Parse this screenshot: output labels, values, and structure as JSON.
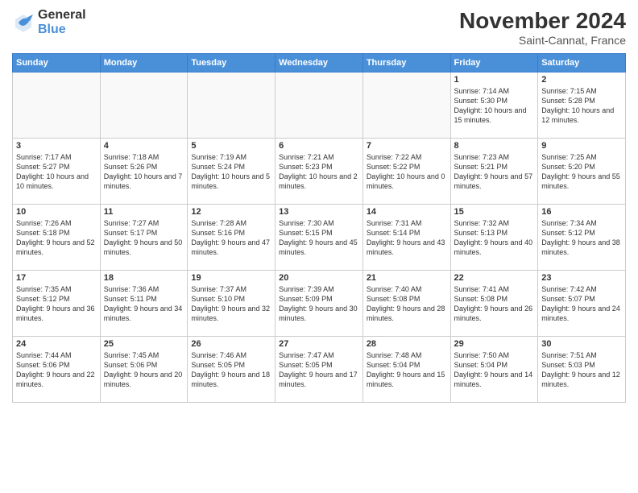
{
  "logo": {
    "general": "General",
    "blue": "Blue"
  },
  "title": "November 2024",
  "location": "Saint-Cannat, France",
  "weekdays": [
    "Sunday",
    "Monday",
    "Tuesday",
    "Wednesday",
    "Thursday",
    "Friday",
    "Saturday"
  ],
  "days": {
    "1": {
      "sunrise": "7:14 AM",
      "sunset": "5:30 PM",
      "daylight": "10 hours and 15 minutes."
    },
    "2": {
      "sunrise": "7:15 AM",
      "sunset": "5:28 PM",
      "daylight": "10 hours and 12 minutes."
    },
    "3": {
      "sunrise": "7:17 AM",
      "sunset": "5:27 PM",
      "daylight": "10 hours and 10 minutes."
    },
    "4": {
      "sunrise": "7:18 AM",
      "sunset": "5:26 PM",
      "daylight": "10 hours and 7 minutes."
    },
    "5": {
      "sunrise": "7:19 AM",
      "sunset": "5:24 PM",
      "daylight": "10 hours and 5 minutes."
    },
    "6": {
      "sunrise": "7:21 AM",
      "sunset": "5:23 PM",
      "daylight": "10 hours and 2 minutes."
    },
    "7": {
      "sunrise": "7:22 AM",
      "sunset": "5:22 PM",
      "daylight": "10 hours and 0 minutes."
    },
    "8": {
      "sunrise": "7:23 AM",
      "sunset": "5:21 PM",
      "daylight": "9 hours and 57 minutes."
    },
    "9": {
      "sunrise": "7:25 AM",
      "sunset": "5:20 PM",
      "daylight": "9 hours and 55 minutes."
    },
    "10": {
      "sunrise": "7:26 AM",
      "sunset": "5:18 PM",
      "daylight": "9 hours and 52 minutes."
    },
    "11": {
      "sunrise": "7:27 AM",
      "sunset": "5:17 PM",
      "daylight": "9 hours and 50 minutes."
    },
    "12": {
      "sunrise": "7:28 AM",
      "sunset": "5:16 PM",
      "daylight": "9 hours and 47 minutes."
    },
    "13": {
      "sunrise": "7:30 AM",
      "sunset": "5:15 PM",
      "daylight": "9 hours and 45 minutes."
    },
    "14": {
      "sunrise": "7:31 AM",
      "sunset": "5:14 PM",
      "daylight": "9 hours and 43 minutes."
    },
    "15": {
      "sunrise": "7:32 AM",
      "sunset": "5:13 PM",
      "daylight": "9 hours and 40 minutes."
    },
    "16": {
      "sunrise": "7:34 AM",
      "sunset": "5:12 PM",
      "daylight": "9 hours and 38 minutes."
    },
    "17": {
      "sunrise": "7:35 AM",
      "sunset": "5:12 PM",
      "daylight": "9 hours and 36 minutes."
    },
    "18": {
      "sunrise": "7:36 AM",
      "sunset": "5:11 PM",
      "daylight": "9 hours and 34 minutes."
    },
    "19": {
      "sunrise": "7:37 AM",
      "sunset": "5:10 PM",
      "daylight": "9 hours and 32 minutes."
    },
    "20": {
      "sunrise": "7:39 AM",
      "sunset": "5:09 PM",
      "daylight": "9 hours and 30 minutes."
    },
    "21": {
      "sunrise": "7:40 AM",
      "sunset": "5:08 PM",
      "daylight": "9 hours and 28 minutes."
    },
    "22": {
      "sunrise": "7:41 AM",
      "sunset": "5:08 PM",
      "daylight": "9 hours and 26 minutes."
    },
    "23": {
      "sunrise": "7:42 AM",
      "sunset": "5:07 PM",
      "daylight": "9 hours and 24 minutes."
    },
    "24": {
      "sunrise": "7:44 AM",
      "sunset": "5:06 PM",
      "daylight": "9 hours and 22 minutes."
    },
    "25": {
      "sunrise": "7:45 AM",
      "sunset": "5:06 PM",
      "daylight": "9 hours and 20 minutes."
    },
    "26": {
      "sunrise": "7:46 AM",
      "sunset": "5:05 PM",
      "daylight": "9 hours and 18 minutes."
    },
    "27": {
      "sunrise": "7:47 AM",
      "sunset": "5:05 PM",
      "daylight": "9 hours and 17 minutes."
    },
    "28": {
      "sunrise": "7:48 AM",
      "sunset": "5:04 PM",
      "daylight": "9 hours and 15 minutes."
    },
    "29": {
      "sunrise": "7:50 AM",
      "sunset": "5:04 PM",
      "daylight": "9 hours and 14 minutes."
    },
    "30": {
      "sunrise": "7:51 AM",
      "sunset": "5:03 PM",
      "daylight": "9 hours and 12 minutes."
    }
  }
}
